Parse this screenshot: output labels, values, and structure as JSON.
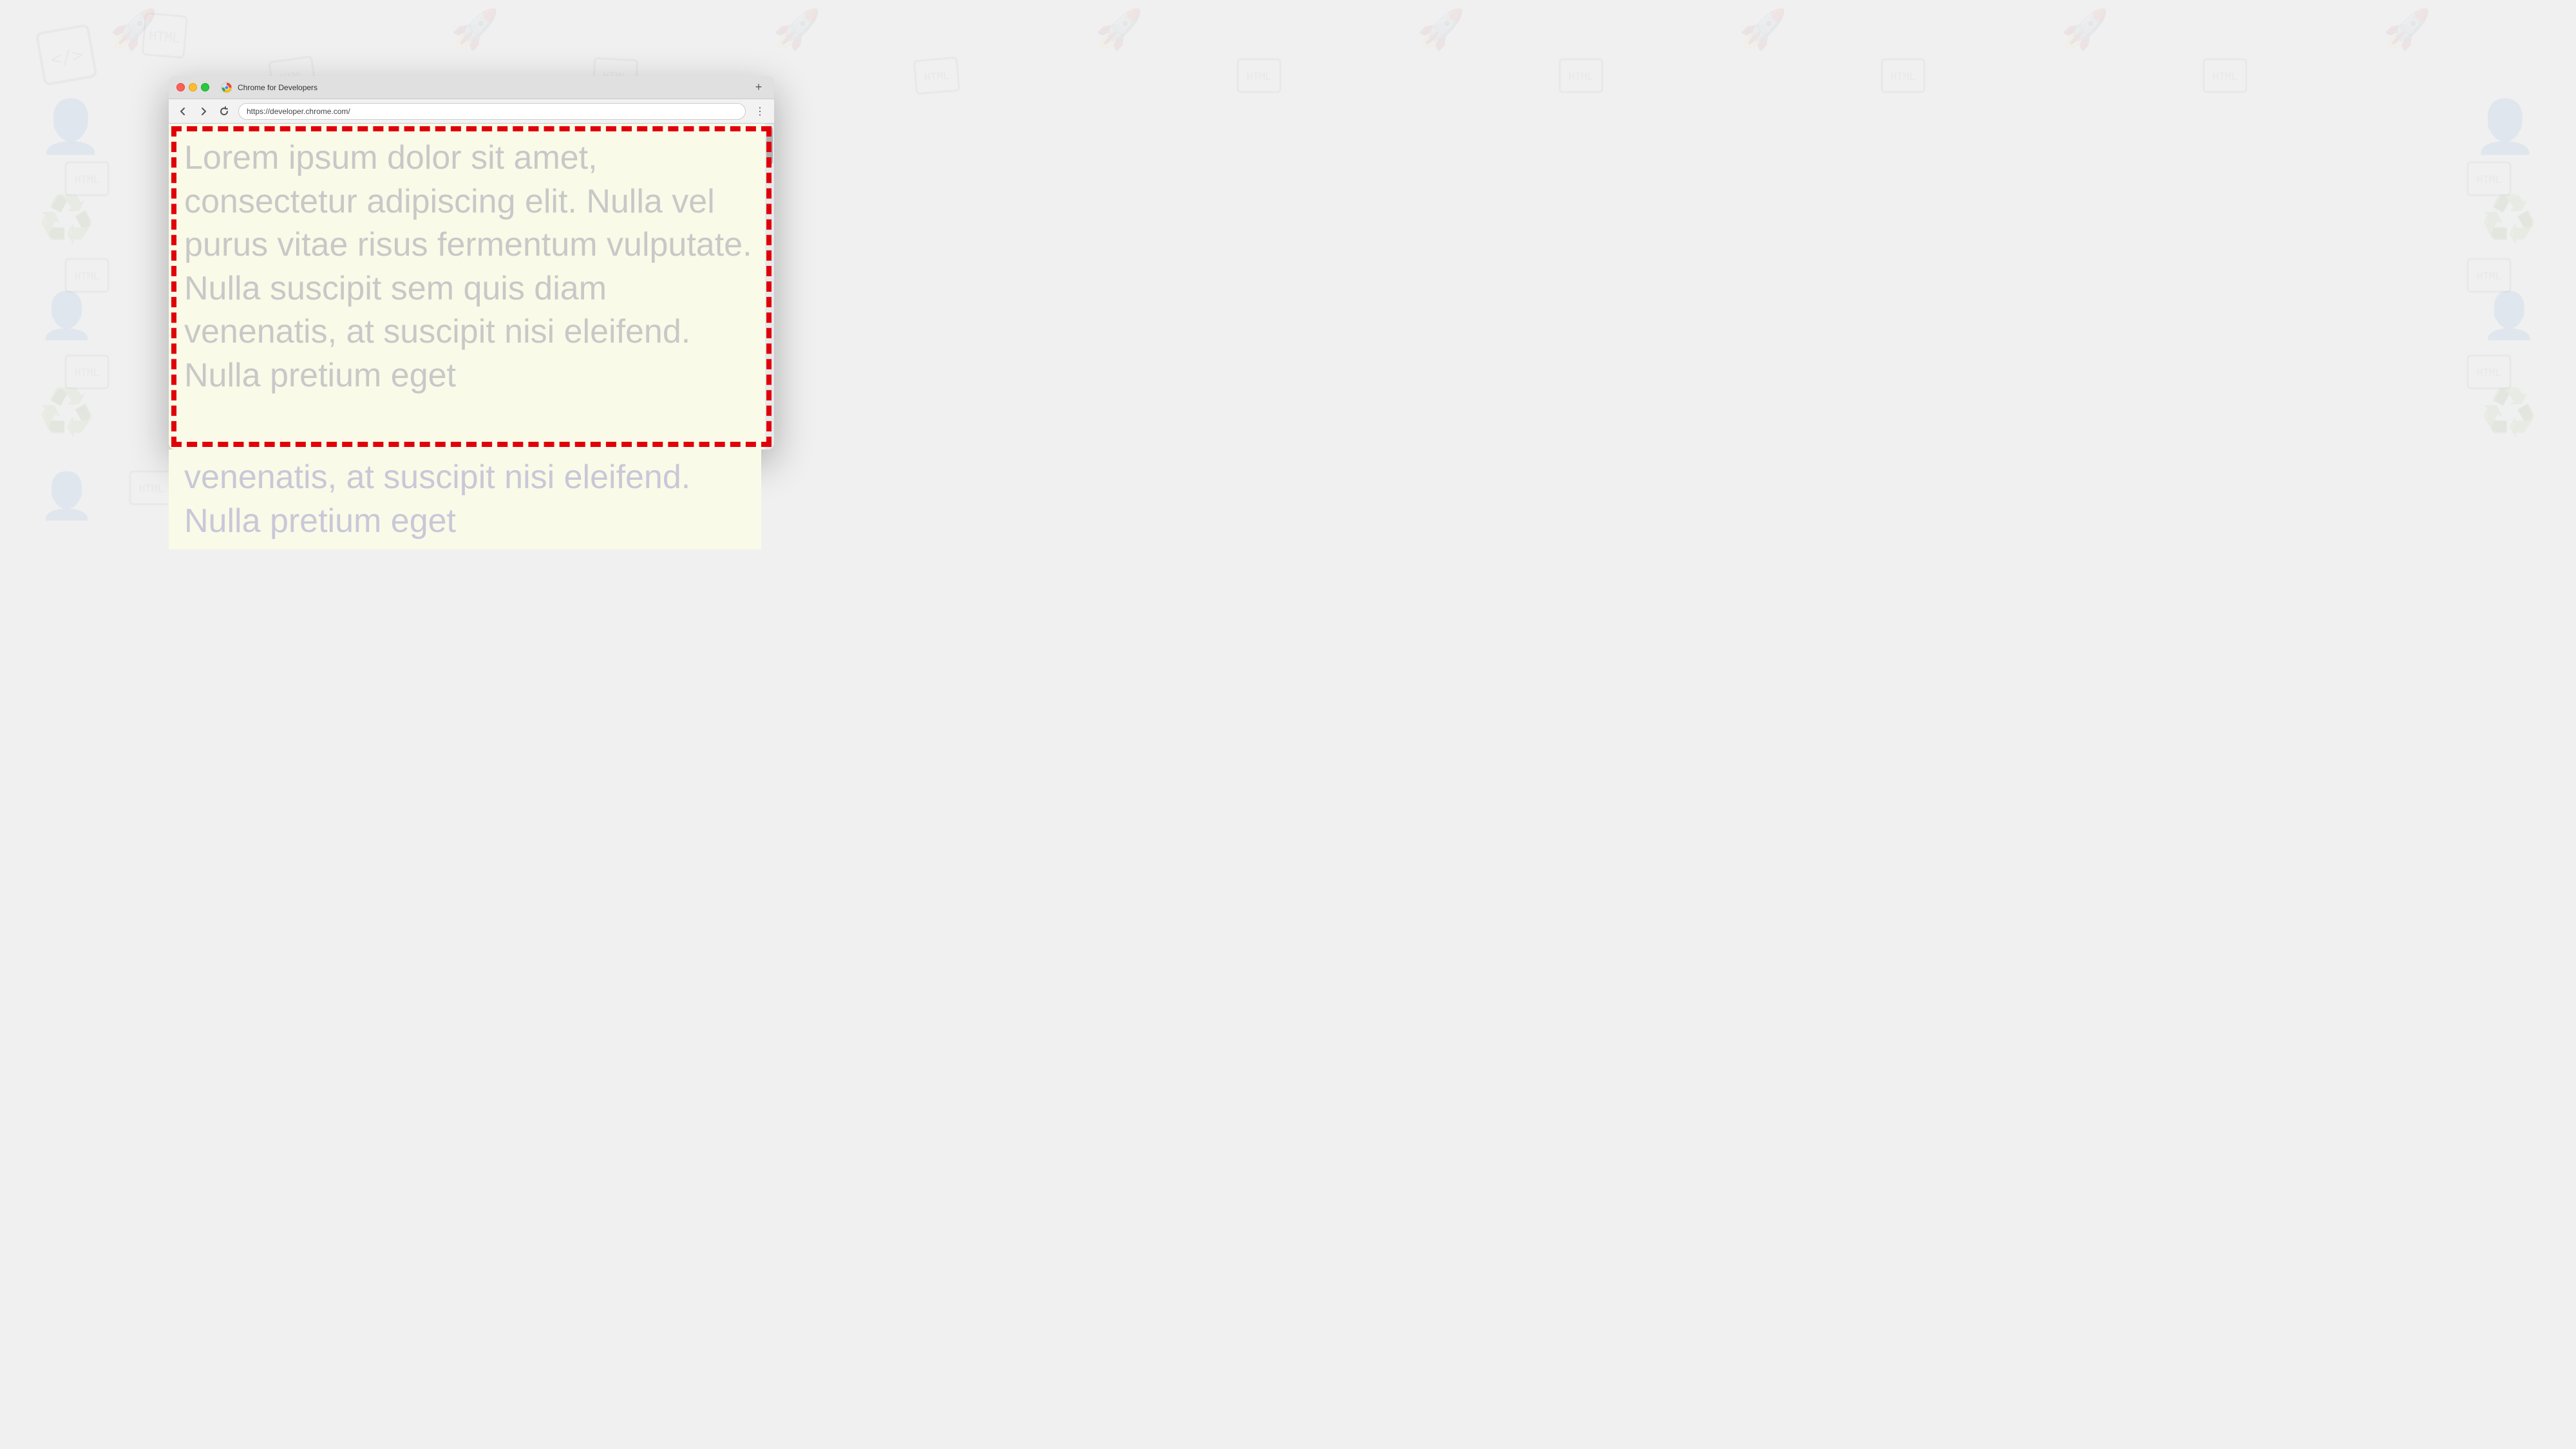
{
  "background": {
    "color": "#f0f0f0"
  },
  "browser": {
    "title_bar": {
      "tab_title": "Chrome for Developers",
      "new_tab_label": "+"
    },
    "nav_bar": {
      "url": "https://developer.chrome.com/",
      "back_title": "Back",
      "forward_title": "Forward",
      "refresh_title": "Refresh",
      "menu_icon": "⋮"
    },
    "page": {
      "lorem_text": "Lorem ipsum dolor sit amet, consectetur adipiscing elit. Nulla vel purus vitae risus fermentum vulputate. Nulla suscipit sem quis diam venenatis, at suscipit nisi eleifend. Nulla pretium eget"
    }
  }
}
